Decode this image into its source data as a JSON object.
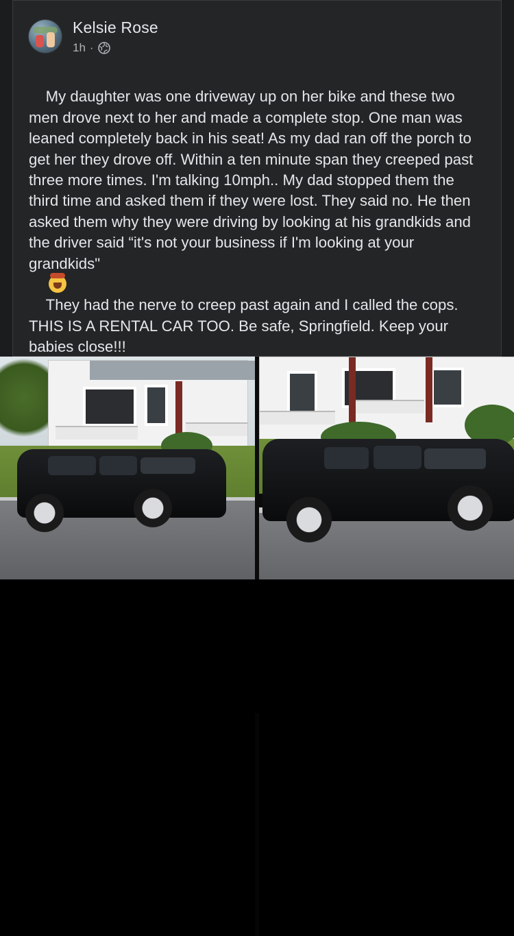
{
  "post": {
    "author": "Kelsie Rose",
    "time": "1h",
    "separator": "·",
    "privacy_icon": "globe-icon",
    "text_before_emoji": "My daughter was one driveway up on her bike and these two men drove next to her and made a complete stop. One man was leaned completely back in his seat! As my dad ran off the porch to get her they drove off. Within a ten minute span they creeped past three more times. I'm talking 10mph.. My dad stopped them the third time and asked them if they were lost. They said no. He then asked them why they were driving by looking at his grandkids and the driver said “it's not your business if I'm looking at your grandkids\"",
    "emoji": "exploding-head-emoji",
    "text_after_emoji": "They had the nerve to creep past again and I called the cops. THIS IS A RENTAL CAR TOO. Be safe, Springfield. Keep your babies close!!!"
  },
  "colors": {
    "post_bg": "#242526",
    "text": "#e4e6eb",
    "secondary_text": "#b0b3b8"
  }
}
